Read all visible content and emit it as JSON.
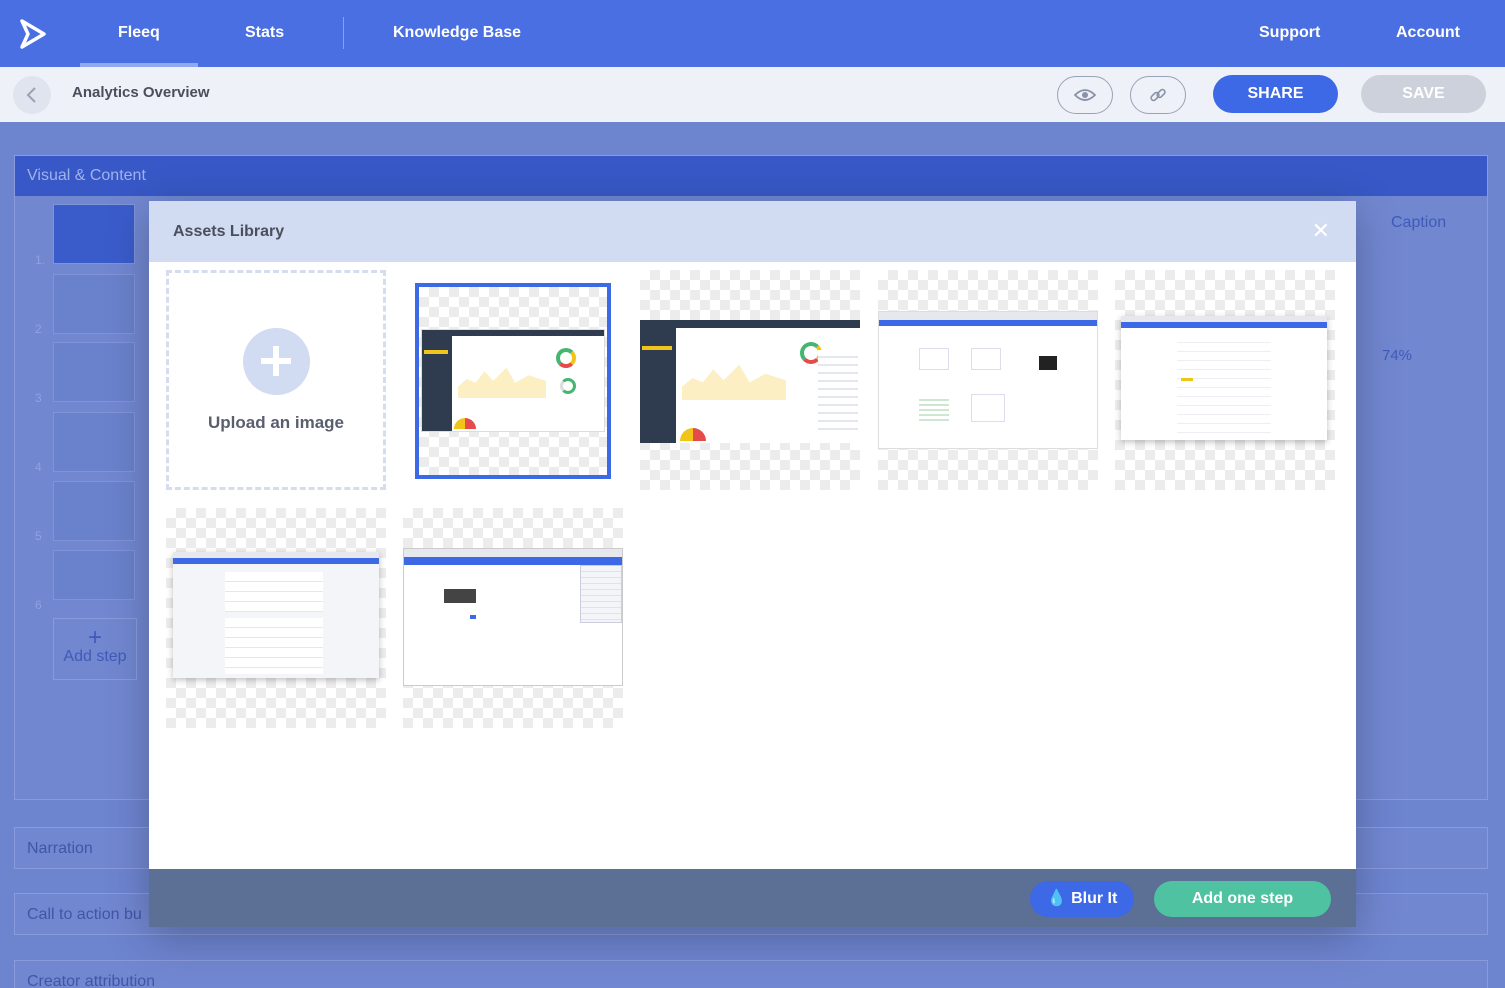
{
  "nav": {
    "items": [
      "Fleeq",
      "Stats",
      "Knowledge Base"
    ],
    "right_items": [
      "Support",
      "Account"
    ],
    "active": "Fleeq"
  },
  "header": {
    "title": "Analytics Overview",
    "share_label": "SHARE",
    "save_label": "SAVE",
    "preview_icon": "eye-icon",
    "link_icon": "link-icon"
  },
  "editor": {
    "visual_section": "Visual & Content",
    "caption_label": "Caption",
    "zoom_value": "74%",
    "step_numbers": [
      "1.",
      "2",
      "3",
      "4",
      "5",
      "6"
    ],
    "add_step_label": "Add step",
    "sections": [
      "Narration",
      "Call to action bu",
      "Creator attribution"
    ]
  },
  "modal": {
    "title": "Assets Library",
    "upload_label": "Upload an image",
    "blur_label": "Blur It",
    "add_step_label": "Add one step",
    "selected_asset_index": 0,
    "asset_count": 6
  },
  "colors": {
    "brand": "#4a6fe3",
    "primary_button": "#3d68e6",
    "success_button": "#4fc3a1",
    "modal_header": "#d1dbf2",
    "modal_footer": "#5c6f95"
  }
}
